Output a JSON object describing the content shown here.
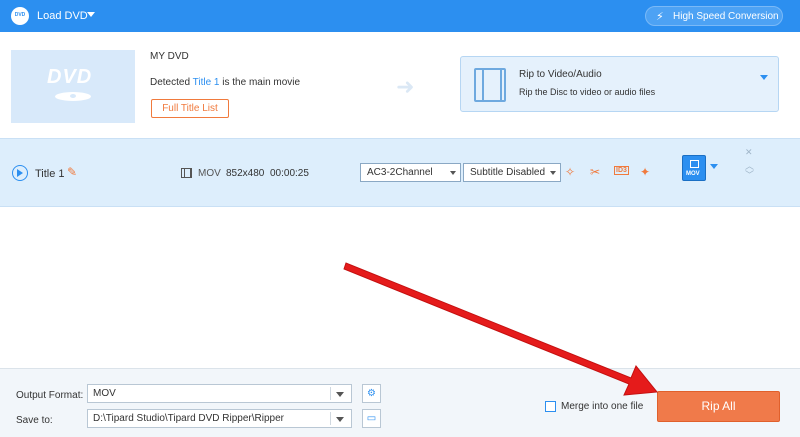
{
  "topbar": {
    "logo_text": "DVD",
    "load_label": "Load DVD",
    "high_speed_label": "High Speed Conversion"
  },
  "source": {
    "thumb_text": "DVD",
    "dvd_name": "MY DVD",
    "detected_prefix": "Detected ",
    "detected_title": "Title 1",
    "detected_suffix": " is the main movie",
    "full_title_list": "Full Title List"
  },
  "rip_mode": {
    "title": "Rip to Video/Audio",
    "subtitle": "Rip the Disc to video or audio files"
  },
  "title_row": {
    "name": "Title 1",
    "format": "MOV",
    "resolution": "852x480",
    "duration": "00:00:25",
    "audio_track": "AC3-2Channel",
    "subtitle": "Subtitle Disabled",
    "id3_label": "ID3",
    "output_badge": "MOV"
  },
  "bottom": {
    "output_format_label": "Output Format:",
    "output_format_value": "MOV",
    "save_to_label": "Save to:",
    "save_to_value": "D:\\Tipard Studio\\Tipard DVD Ripper\\Ripper",
    "merge_label": "Merge into one file",
    "rip_all_label": "Rip All"
  },
  "colors": {
    "accent_blue": "#2c8ff0",
    "accent_orange": "#f07a4a",
    "annotation_red": "#e51b1b"
  }
}
